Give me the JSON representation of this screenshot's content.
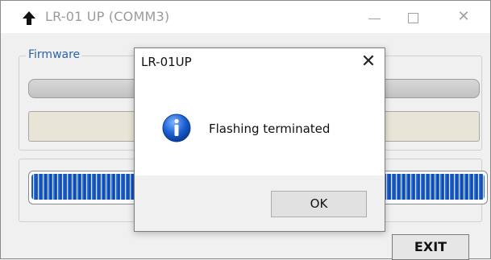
{
  "window": {
    "title": "LR-01 UP   (COMM3)",
    "app_icon": "up-arrow-icon",
    "controls": {
      "minimize_icon": "minimize-icon",
      "maximize_icon": "maximize-icon",
      "close_icon": "close-icon",
      "close_glyph": "✕"
    }
  },
  "firmware_group": {
    "label": "Firmware"
  },
  "progress": {
    "fraction": 1.0
  },
  "exit_button": {
    "label": "EXIT"
  },
  "dialog": {
    "title": "LR-01UP",
    "close_glyph": "✕",
    "icon": "info-icon",
    "message": "Flashing terminated",
    "ok_label": "OK"
  },
  "colors": {
    "group_label": "#2f63a6",
    "progress_blue": "#1f5bbd",
    "info_icon": "#1a5fd0"
  }
}
